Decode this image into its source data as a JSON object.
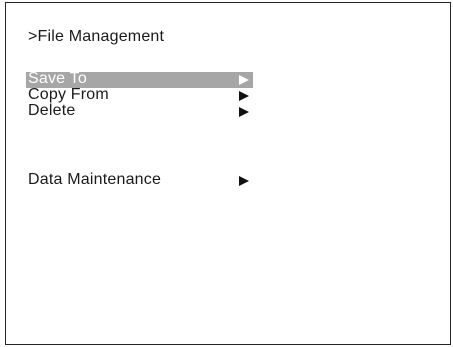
{
  "screen": {
    "title": ">File Management"
  },
  "menu": {
    "items": [
      {
        "label": "Save To",
        "selected": true,
        "arrow_icon": "triangle-right-icon"
      },
      {
        "label": "Copy From",
        "selected": false,
        "arrow_icon": "triangle-right-icon"
      },
      {
        "label": "Delete",
        "selected": false,
        "arrow_icon": "triangle-right-icon"
      }
    ],
    "maintenance": {
      "label": "Data Maintenance",
      "selected": false,
      "arrow_icon": "triangle-right-icon"
    }
  },
  "colors": {
    "highlight": "#a6a6a6",
    "text": "#1a1a1a",
    "border": "#262626"
  }
}
